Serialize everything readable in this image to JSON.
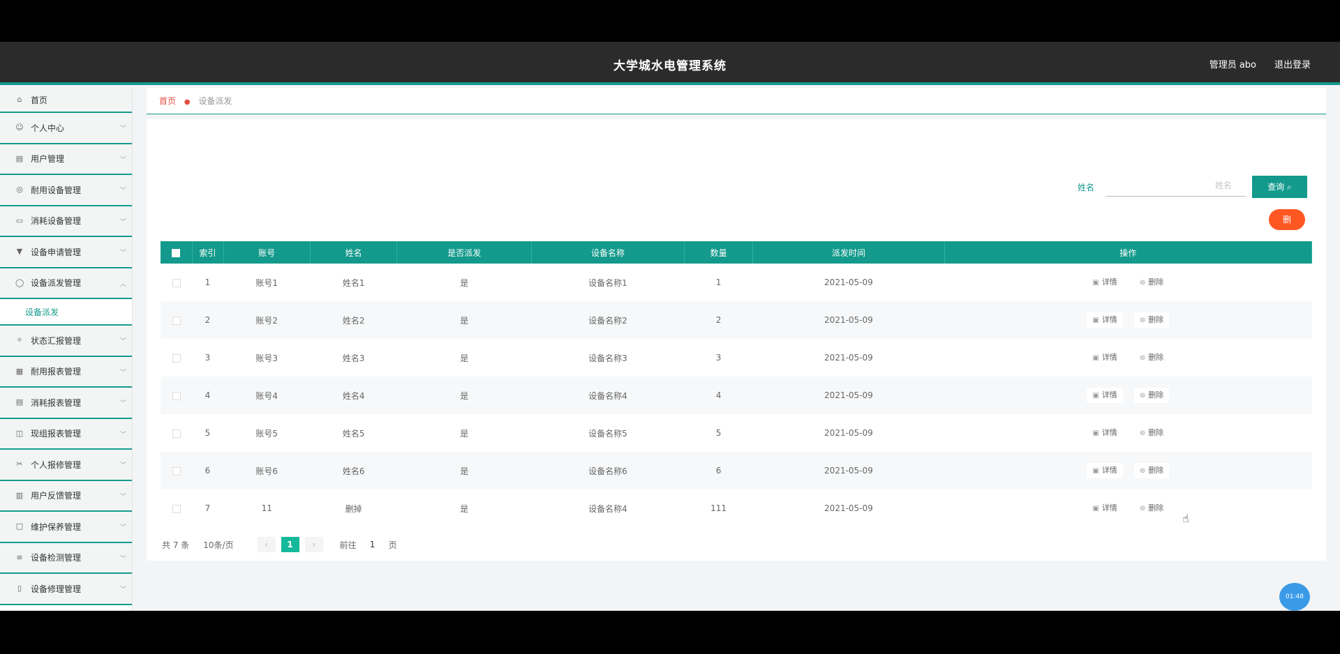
{
  "header": {
    "title": "大学城水电管理系统",
    "user": "管理员 abo",
    "logout": "退出登录"
  },
  "sidebar": {
    "items": [
      {
        "label": "首页",
        "icon": "home-icon",
        "has_arrow": false
      },
      {
        "label": "个人中心",
        "icon": "user-icon",
        "has_arrow": true
      },
      {
        "label": "用户管理",
        "icon": "list-icon",
        "has_arrow": true
      },
      {
        "label": "耐用设备管理",
        "icon": "device-icon",
        "has_arrow": true
      },
      {
        "label": "消耗设备管理",
        "icon": "box-icon",
        "has_arrow": true
      },
      {
        "label": "设备申请管理",
        "icon": "apply-icon",
        "has_arrow": true
      },
      {
        "label": "设备派发管理",
        "icon": "dispatch-icon",
        "has_arrow": true,
        "expanded": true,
        "subitems": [
          "设备派发"
        ]
      },
      {
        "label": "状态汇报管理",
        "icon": "report-icon",
        "has_arrow": true
      },
      {
        "label": "耐用报表管理",
        "icon": "grid-icon",
        "has_arrow": true
      },
      {
        "label": "消耗报表管理",
        "icon": "sheet-icon",
        "has_arrow": true
      },
      {
        "label": "现组报表管理",
        "icon": "chart-icon",
        "has_arrow": true
      },
      {
        "label": "个人报修管理",
        "icon": "repair-icon",
        "has_arrow": true
      },
      {
        "label": "用户反馈管理",
        "icon": "feedback-icon",
        "has_arrow": true
      },
      {
        "label": "维护保养管理",
        "icon": "maintain-icon",
        "has_arrow": true
      },
      {
        "label": "设备检测管理",
        "icon": "menu-icon",
        "has_arrow": true
      },
      {
        "label": "设备修理管理",
        "icon": "fix-icon",
        "has_arrow": true
      }
    ]
  },
  "breadcrumb": {
    "home": "首页",
    "current": "设备派发"
  },
  "search": {
    "label": "姓名",
    "placeholder": "姓名",
    "button": "查询"
  },
  "delete_button": "删",
  "table": {
    "headers": [
      "索引",
      "账号",
      "姓名",
      "是否派发",
      "设备名称",
      "数量",
      "派发时间",
      "操作"
    ],
    "rows": [
      {
        "index": "1",
        "account": "账号1",
        "name": "姓名1",
        "dispatched": "是",
        "device": "设备名称1",
        "qty": "1",
        "time": "2021-05-09"
      },
      {
        "index": "2",
        "account": "账号2",
        "name": "姓名2",
        "dispatched": "是",
        "device": "设备名称2",
        "qty": "2",
        "time": "2021-05-09"
      },
      {
        "index": "3",
        "account": "账号3",
        "name": "姓名3",
        "dispatched": "是",
        "device": "设备名称3",
        "qty": "3",
        "time": "2021-05-09"
      },
      {
        "index": "4",
        "account": "账号4",
        "name": "姓名4",
        "dispatched": "是",
        "device": "设备名称4",
        "qty": "4",
        "time": "2021-05-09"
      },
      {
        "index": "5",
        "account": "账号5",
        "name": "姓名5",
        "dispatched": "是",
        "device": "设备名称5",
        "qty": "5",
        "time": "2021-05-09"
      },
      {
        "index": "6",
        "account": "账号6",
        "name": "姓名6",
        "dispatched": "是",
        "device": "设备名称6",
        "qty": "6",
        "time": "2021-05-09"
      },
      {
        "index": "7",
        "account": "11",
        "name": "删掉",
        "dispatched": "是",
        "device": "设备名称4",
        "qty": "111",
        "time": "2021-05-09"
      }
    ],
    "detail_label": "详情",
    "delete_label": "删除"
  },
  "pager": {
    "total": "共 7 条",
    "page_size": "10条/页",
    "current": "1",
    "goto_label": "前往",
    "goto_value": "1",
    "page_unit": "页"
  },
  "bubble": "01:48",
  "colors": {
    "accent": "#139a8c",
    "danger": "#ff5722",
    "header_bg": "#2b2b2b",
    "crumb": "#e54d42"
  }
}
